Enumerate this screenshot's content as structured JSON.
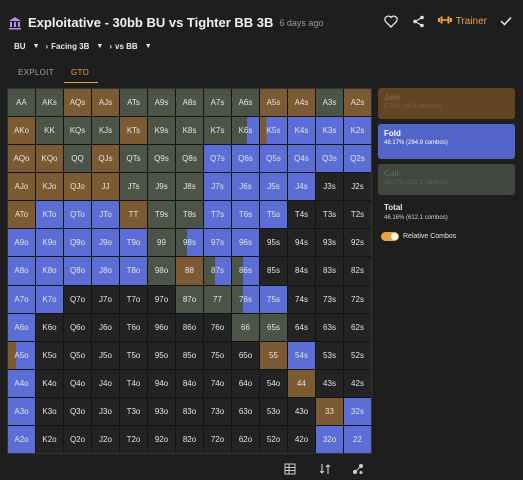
{
  "header": {
    "title": "Exploitative - 30bb BU vs Tighter BB 3B",
    "ago": "6 days ago",
    "trainer_label": "Trainer"
  },
  "breadcrumb": [
    "BU",
    "Facing 3B",
    "vs BB"
  ],
  "tabs": [
    {
      "label": "EXPLOIT",
      "active": false
    },
    {
      "label": "GTO",
      "active": true
    }
  ],
  "colors": {
    "jam": "#7c5a33",
    "fold": "#5d6dd6",
    "call": "#4b5447",
    "empty": "#232323",
    "accent": "#f0a040"
  },
  "grid": {
    "hands": [
      [
        "AA",
        "AKs",
        "AQs",
        "AJs",
        "ATs",
        "A9s",
        "A8s",
        "A7s",
        "A6s",
        "A5s",
        "A4s",
        "A3s",
        "A2s"
      ],
      [
        "AKo",
        "KK",
        "KQs",
        "KJs",
        "KTs",
        "K9s",
        "K8s",
        "K7s",
        "K6s",
        "K5s",
        "K4s",
        "K3s",
        "K2s"
      ],
      [
        "AQo",
        "KQo",
        "QQ",
        "QJs",
        "QTs",
        "Q9s",
        "Q8s",
        "Q7s",
        "Q6s",
        "Q5s",
        "Q4s",
        "Q3s",
        "Q2s"
      ],
      [
        "AJo",
        "KJo",
        "QJo",
        "JJ",
        "JTs",
        "J9s",
        "J8s",
        "J7s",
        "J6s",
        "J5s",
        "J4s",
        "J3s",
        "J2s"
      ],
      [
        "ATo",
        "KTo",
        "QTo",
        "JTo",
        "TT",
        "T9s",
        "T8s",
        "T7s",
        "T6s",
        "T5s",
        "T4s",
        "T3s",
        "T2s"
      ],
      [
        "A9o",
        "K9o",
        "Q9o",
        "J9o",
        "T9o",
        "99",
        "98s",
        "97s",
        "96s",
        "95s",
        "94s",
        "93s",
        "92s"
      ],
      [
        "A8o",
        "K8o",
        "Q8o",
        "J8o",
        "T8o",
        "98o",
        "88",
        "87s",
        "86s",
        "85s",
        "84s",
        "83s",
        "82s"
      ],
      [
        "A7o",
        "K7o",
        "Q7o",
        "J7o",
        "T7o",
        "97o",
        "87o",
        "77",
        "76s",
        "75s",
        "74s",
        "73s",
        "72s"
      ],
      [
        "A6o",
        "K6o",
        "Q6o",
        "J6o",
        "T6o",
        "96o",
        "86o",
        "76o",
        "66",
        "65s",
        "64s",
        "63s",
        "62s"
      ],
      [
        "A5o",
        "K5o",
        "Q5o",
        "J5o",
        "T5o",
        "95o",
        "85o",
        "75o",
        "65o",
        "55",
        "54s",
        "53s",
        "52s"
      ],
      [
        "A4o",
        "K4o",
        "Q4o",
        "J4o",
        "T4o",
        "94o",
        "84o",
        "74o",
        "64o",
        "54o",
        "44",
        "43s",
        "42s"
      ],
      [
        "A3o",
        "K3o",
        "Q3o",
        "J3o",
        "T3o",
        "93o",
        "83o",
        "73o",
        "63o",
        "53o",
        "43o",
        "33",
        "32s"
      ],
      [
        "A2o",
        "K2o",
        "Q2o",
        "J2o",
        "T2o",
        "92o",
        "82o",
        "72o",
        "62o",
        "52o",
        "42o",
        "32o",
        "22"
      ]
    ],
    "strategy": [
      [
        "C",
        "C",
        "J",
        "J",
        "C",
        "C",
        "C",
        "C",
        "C",
        "J",
        "J",
        "C",
        "J"
      ],
      [
        "J",
        "C",
        "C",
        "C",
        "J",
        "C",
        "C",
        "C",
        "MCF",
        "MFJ",
        "F",
        "F",
        "F"
      ],
      [
        "J",
        "J",
        "C",
        "J",
        "C",
        "C",
        "C",
        "F",
        "F",
        "F",
        "F",
        "F",
        "F"
      ],
      [
        "J",
        "J",
        "J",
        "J",
        "C",
        "C",
        "C",
        "F",
        "F",
        "F",
        "F",
        "E",
        "E"
      ],
      [
        "J",
        "F",
        "F",
        "F",
        "J",
        "C",
        "C",
        "F",
        "F",
        "F",
        "E",
        "E",
        "E"
      ],
      [
        "F",
        "F",
        "F",
        "F",
        "F",
        "C",
        "CF",
        "F",
        "F",
        "E",
        "E",
        "E",
        "E"
      ],
      [
        "F",
        "F",
        "F",
        "F",
        "F",
        "C",
        "J",
        "CF",
        "CF",
        "E",
        "E",
        "E",
        "E"
      ],
      [
        "F",
        "F",
        "E",
        "E",
        "E",
        "E",
        "C",
        "C",
        "CF",
        "F",
        "E",
        "E",
        "E"
      ],
      [
        "F",
        "E",
        "E",
        "E",
        "E",
        "E",
        "E",
        "E",
        "C",
        "C",
        "E",
        "E",
        "E"
      ],
      [
        "JF",
        "E",
        "E",
        "E",
        "E",
        "E",
        "E",
        "E",
        "E",
        "J",
        "F",
        "E",
        "E"
      ],
      [
        "F",
        "E",
        "E",
        "E",
        "E",
        "E",
        "E",
        "E",
        "E",
        "E",
        "J",
        "E",
        "E"
      ],
      [
        "F",
        "E",
        "E",
        "E",
        "E",
        "E",
        "E",
        "E",
        "E",
        "E",
        "E",
        "J",
        "F"
      ],
      [
        "F",
        "E",
        "E",
        "E",
        "E",
        "E",
        "E",
        "E",
        "E",
        "E",
        "E",
        "F",
        "F"
      ]
    ]
  },
  "panel": {
    "actions": [
      {
        "name": "Jam",
        "detail": "5.72% (35.1 combos)"
      },
      {
        "name": "Fold",
        "detail": "48.17% (294.9 combos)"
      },
      {
        "name": "Call",
        "detail": "42.27% (262.1 combos)"
      }
    ],
    "total_label": "Total",
    "total_value": "46.16% (612.1 combos)",
    "relative_label": "Relative Combos"
  }
}
